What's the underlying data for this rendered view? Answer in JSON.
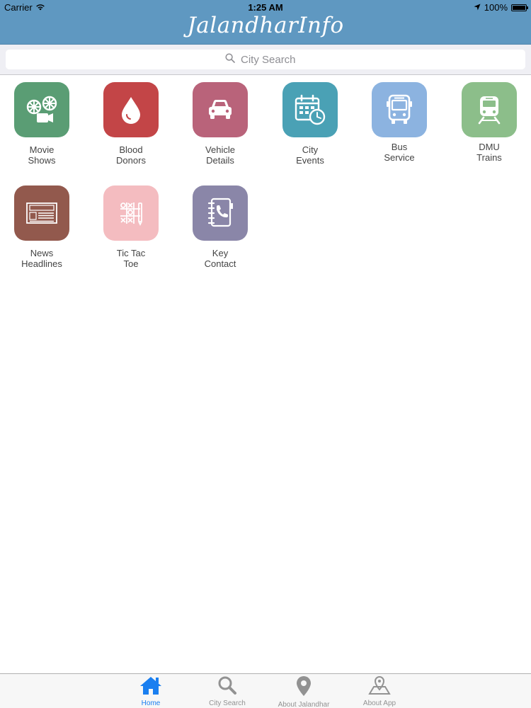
{
  "status_bar": {
    "carrier": "Carrier",
    "time": "1:25 AM",
    "battery": "100%",
    "battery_level": 1.0
  },
  "header": {
    "title": "JalandharInfo"
  },
  "search": {
    "placeholder": "City Search"
  },
  "tiles": [
    {
      "line1": "Movie",
      "line2": "Shows",
      "color": "#5a9d74",
      "icon": "film-reels-icon"
    },
    {
      "line1": "Blood",
      "line2": "Donors",
      "color": "#c34547",
      "icon": "blood-drop-icon"
    },
    {
      "line1": "Vehicle",
      "line2": "Details",
      "color": "#b9637a",
      "icon": "car-icon"
    },
    {
      "line1": "City",
      "line2": "Events",
      "color": "#4aa1b5",
      "icon": "calendar-clock-icon"
    },
    {
      "line1": "Bus",
      "line2": "Service",
      "color": "#8cb3e0",
      "icon": "bus-icon"
    },
    {
      "line1": "DMU",
      "line2": "Trains",
      "color": "#8cbe8a",
      "icon": "train-icon"
    },
    {
      "line1": "News",
      "line2": "Headlines",
      "color": "#92594d",
      "icon": "newspaper-icon"
    },
    {
      "line1": "Tic Tac",
      "line2": "Toe",
      "color": "#f4bcc0",
      "icon": "tic-tac-toe-icon"
    },
    {
      "line1": "Key",
      "line2": "Contact",
      "color": "#8a86a8",
      "icon": "contact-book-icon"
    }
  ],
  "tabbar": {
    "items": [
      {
        "label": "Home",
        "icon": "home-icon",
        "active": true
      },
      {
        "label": "City Search",
        "icon": "search-icon",
        "active": false
      },
      {
        "label": "About Jalandhar",
        "icon": "location-pin-icon",
        "active": false
      },
      {
        "label": "About App",
        "icon": "map-pin-icon",
        "active": false
      }
    ],
    "active_color": "#1a7ff0",
    "inactive_color": "#929292"
  }
}
